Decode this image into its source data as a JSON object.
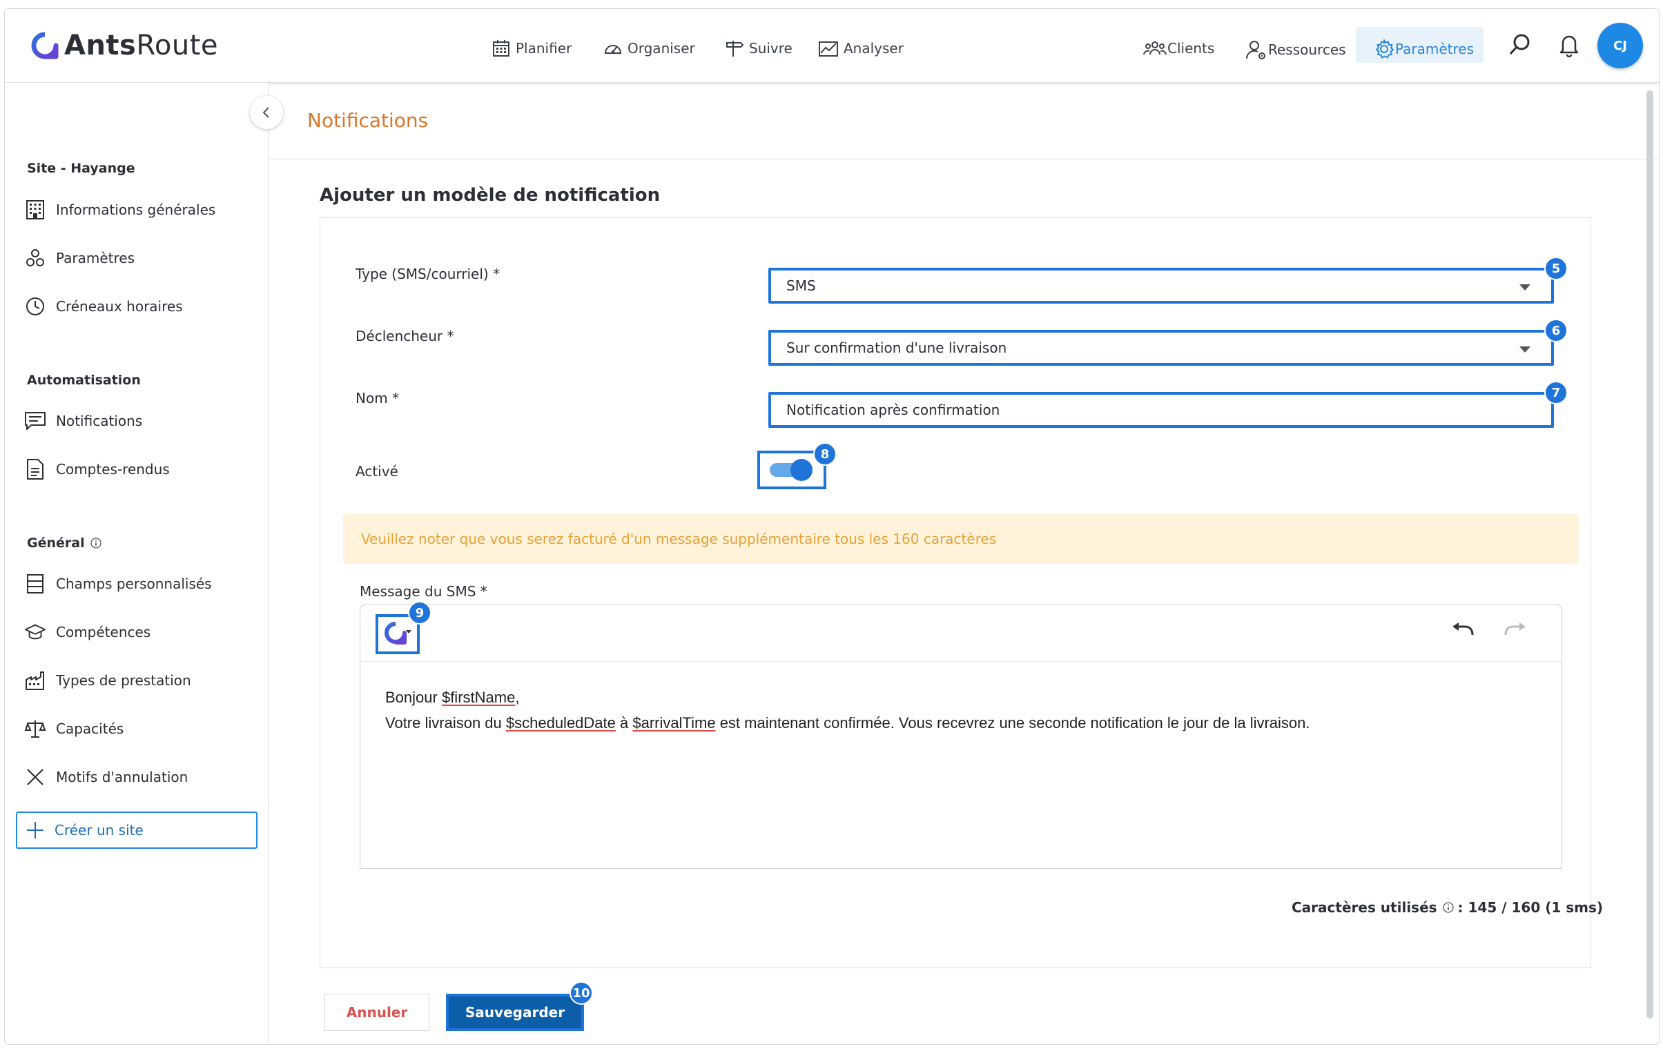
{
  "app": {
    "logo_bold": "Ants",
    "logo_light": "Route"
  },
  "nav": {
    "planifier": "Planifier",
    "organiser": "Organiser",
    "suivre": "Suivre",
    "analyser": "Analyser",
    "clients": "Clients",
    "ressources": "Ressources",
    "parametres": "Paramètres",
    "avatar_initials": "CJ"
  },
  "sidebar": {
    "site_title": "Site - Hayange",
    "site_items": [
      "Informations générales",
      "Paramètres",
      "Créneaux horaires"
    ],
    "automation_title": "Automatisation",
    "automation_items": [
      "Notifications",
      "Comptes-rendus"
    ],
    "general_title": "Général",
    "general_items": [
      "Champs personnalisés",
      "Compétences",
      "Types de prestation",
      "Capacités",
      "Motifs d'annulation"
    ],
    "create_site": "Créer un site"
  },
  "page": {
    "title": "Notifications"
  },
  "form": {
    "title": "Ajouter un modèle de notification",
    "type_label": "Type (SMS/courriel) *",
    "type_value": "SMS",
    "trigger_label": "Déclencheur *",
    "trigger_value": "Sur confirmation d'une livraison",
    "name_label": "Nom *",
    "name_value": "Notification après confirmation",
    "active_label": "Activé",
    "active": true,
    "warning": "Veuillez noter que vous serez facturé d'un message supplémentaire tous les 160 caractères",
    "message_label": "Message du SMS *",
    "message": {
      "l1_pre": "Bonjour ",
      "l1_var": "$firstName",
      "l1_post": ",",
      "l2_a": "Votre livraison du ",
      "l2_var1": "$scheduledDate",
      "l2_b": " à ",
      "l2_var2": "$arrivalTime",
      "l2_c": " est maintenant confirmée. Vous recevrez une seconde notification le jour de la livraison."
    },
    "counter_label": "Caractères utilisés",
    "counter_value": ": 145 / 160 (1 sms)",
    "cancel": "Annuler",
    "save": "Sauvegarder"
  },
  "badges": {
    "b5": "5",
    "b6": "6",
    "b7": "7",
    "b8": "8",
    "b9": "9",
    "b10": "10"
  },
  "colors": {
    "accent": "#1e74d8",
    "title_orange": "#d9772a",
    "warning_bg": "#fff3dc",
    "warning_text": "#e6a233",
    "save_bg": "#0d5ea8",
    "cancel_text": "#d9534f"
  }
}
